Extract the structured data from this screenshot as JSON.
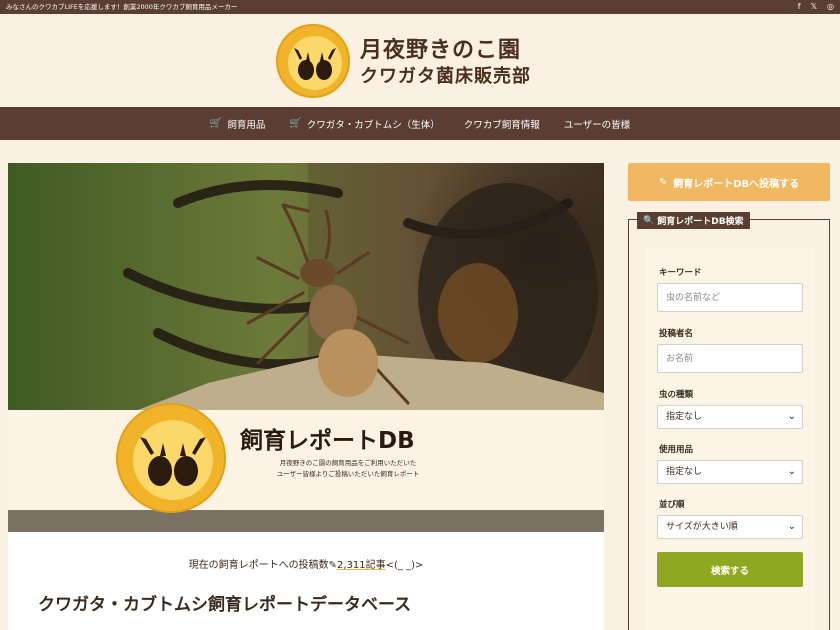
{
  "topbar": {
    "tagline": "みなさんのクワカブLIFEを応援します！創業2000年クワカブ飼育用品メーカー",
    "social": [
      "f",
      "𝕏",
      "◎"
    ]
  },
  "header": {
    "title": "月夜野きのこ園",
    "subtitle": "クワガタ菌床販売部",
    "logo_top_text": "月夜野きのこ園",
    "logo_bottom_text": "クワガタ菌床販売部"
  },
  "nav": {
    "items": [
      {
        "label": "飼育用品",
        "cart": true
      },
      {
        "label": "クワガタ・カブトムシ（生体）",
        "cart": true
      },
      {
        "label": "クワカブ飼育情報",
        "cart": false
      },
      {
        "label": "ユーザーの皆様",
        "cart": false
      }
    ]
  },
  "hero": {
    "banner_title": "飼育レポートDB",
    "banner_desc_line1": "月夜野きのこ園の飼育用品をご利用いただいた",
    "banner_desc_line2": "ユーザー皆様よりご投稿いただいた飼育レポート",
    "logo_top_text": "月夜野きのこ園",
    "logo_bottom_text": "クワガタ菌床販売部"
  },
  "main": {
    "count_prefix": "現在の飼育レポートへの投稿数",
    "count_value": "2,311記事",
    "count_suffix": "<(_ _)>",
    "page_title": "クワガタ・カブトムシ飼育レポートデータベース"
  },
  "sidebar": {
    "post_button": "飼育レポートDBへ投稿する",
    "search_title": "飼育レポートDB検索",
    "keyword_label": "キーワード",
    "keyword_placeholder": "虫の名前など",
    "poster_label": "投稿者名",
    "poster_placeholder": "お名前",
    "species_label": "虫の種類",
    "species_value": "指定なし",
    "product_label": "使用用品",
    "product_value": "指定なし",
    "sort_label": "並び順",
    "sort_value": "サイズが大きい順",
    "submit_label": "検索する"
  },
  "colors": {
    "brown": "#5a3e31",
    "cream": "#fbf1e2",
    "orange": "#f0b860",
    "green": "#8fa721",
    "logo_yellow": "#f0b32a"
  }
}
